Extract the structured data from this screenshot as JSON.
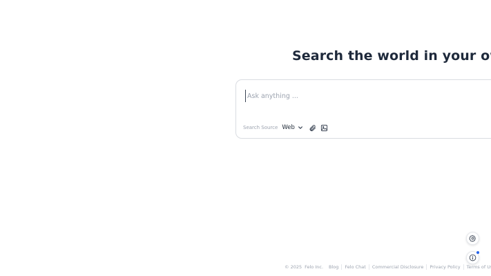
{
  "hero": {
    "headline": "Search the world in your own languag"
  },
  "search": {
    "placeholder": "Ask anything ...",
    "value": "",
    "source_label": "Search Source",
    "source_selected": "Web",
    "icons": [
      "chevron-down-icon",
      "paperclip-icon",
      "image-icon"
    ]
  },
  "floating_buttons": {
    "icons": [
      "settings-icon",
      "info-icon"
    ],
    "notification_color": "#2563eb"
  },
  "footer": {
    "copyright": "© 2025",
    "company": "Felo Inc.",
    "links": [
      "Blog",
      "Felo Chat",
      "Commercial Disclosure",
      "Privacy Policy",
      "Terms of Use"
    ],
    "social_icon": "x-logo-icon"
  }
}
